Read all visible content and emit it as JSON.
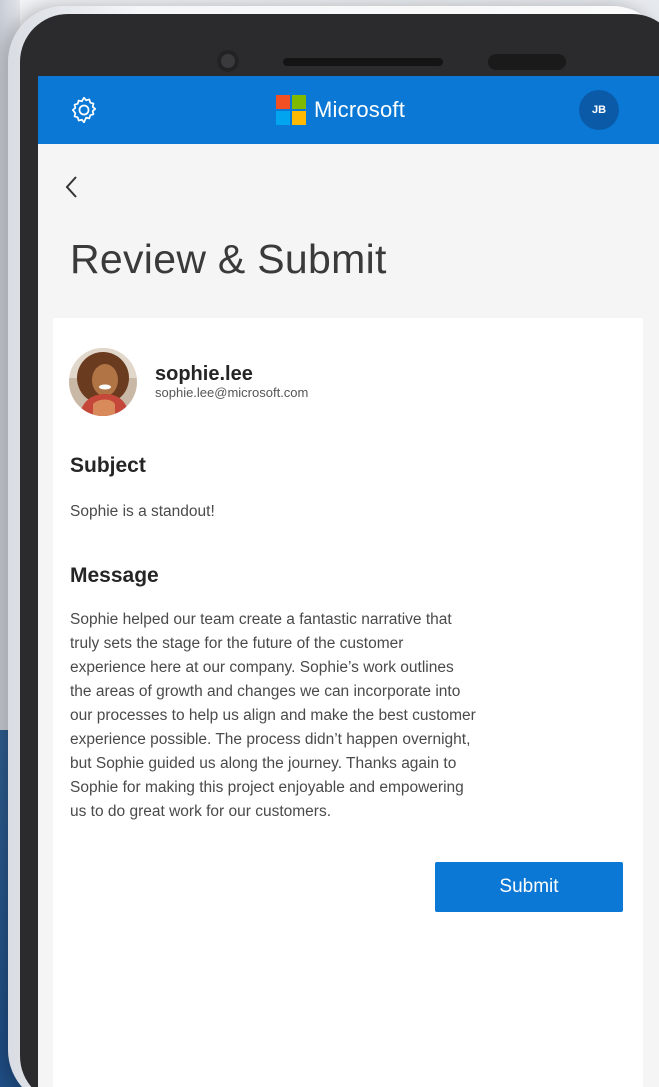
{
  "header": {
    "brand": "Microsoft",
    "avatar_initials": "JB",
    "settings_icon": "gear-icon",
    "logo_colors": [
      "#f25022",
      "#7fba00",
      "#00a4ef",
      "#ffb900"
    ]
  },
  "nav": {
    "back_icon": "chevron-left-icon"
  },
  "page": {
    "title": "Review & Submit"
  },
  "sender": {
    "name": "sophie.lee",
    "email": "sophie.lee@microsoft.com"
  },
  "subject": {
    "label": "Subject",
    "value": "Sophie is a standout!"
  },
  "message": {
    "label": "Message",
    "lines": [
      "Sophie helped our team create a fantastic narrative that",
      "truly sets the stage for the future of the customer",
      "experience here at our company. Sophie’s work outlines",
      "the areas of growth and changes we can incorporate into",
      "our processes to help us align and make the best customer",
      "experience possible. The process didn’t happen overnight,",
      "but Sophie guided us along the journey. Thanks again to",
      "Sophie for making this project enjoyable and empowering",
      "us to do great work for our customers."
    ]
  },
  "actions": {
    "submit_label": "Submit"
  },
  "colors": {
    "accent": "#0a78d4"
  }
}
